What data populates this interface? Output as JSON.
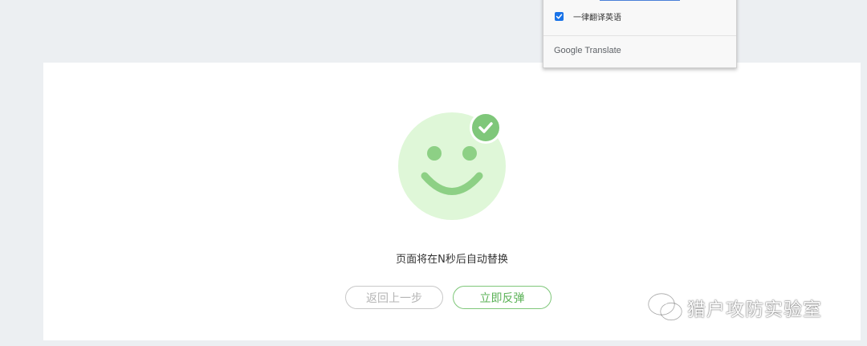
{
  "translate_popup": {
    "always_translate_label": "一律翻译英语",
    "always_translate_checked": true,
    "brand": "Google Translate"
  },
  "main": {
    "message": "页面将在N秒后自动替换",
    "back_button_label": "返回上一步",
    "bounce_button_label": "立即反弹",
    "status_icon": "check-icon",
    "illustration": "smiley-face"
  },
  "watermark": {
    "text": "猎户攻防实验室",
    "icon": "wechat-icon"
  },
  "colors": {
    "page_background": "#eceff2",
    "card_background": "#ffffff",
    "smiley_fill": "#dff7d8",
    "smiley_features": "#8dd085",
    "accent_green": "#7fc77a",
    "checkbox_blue": "#1a73e8"
  }
}
